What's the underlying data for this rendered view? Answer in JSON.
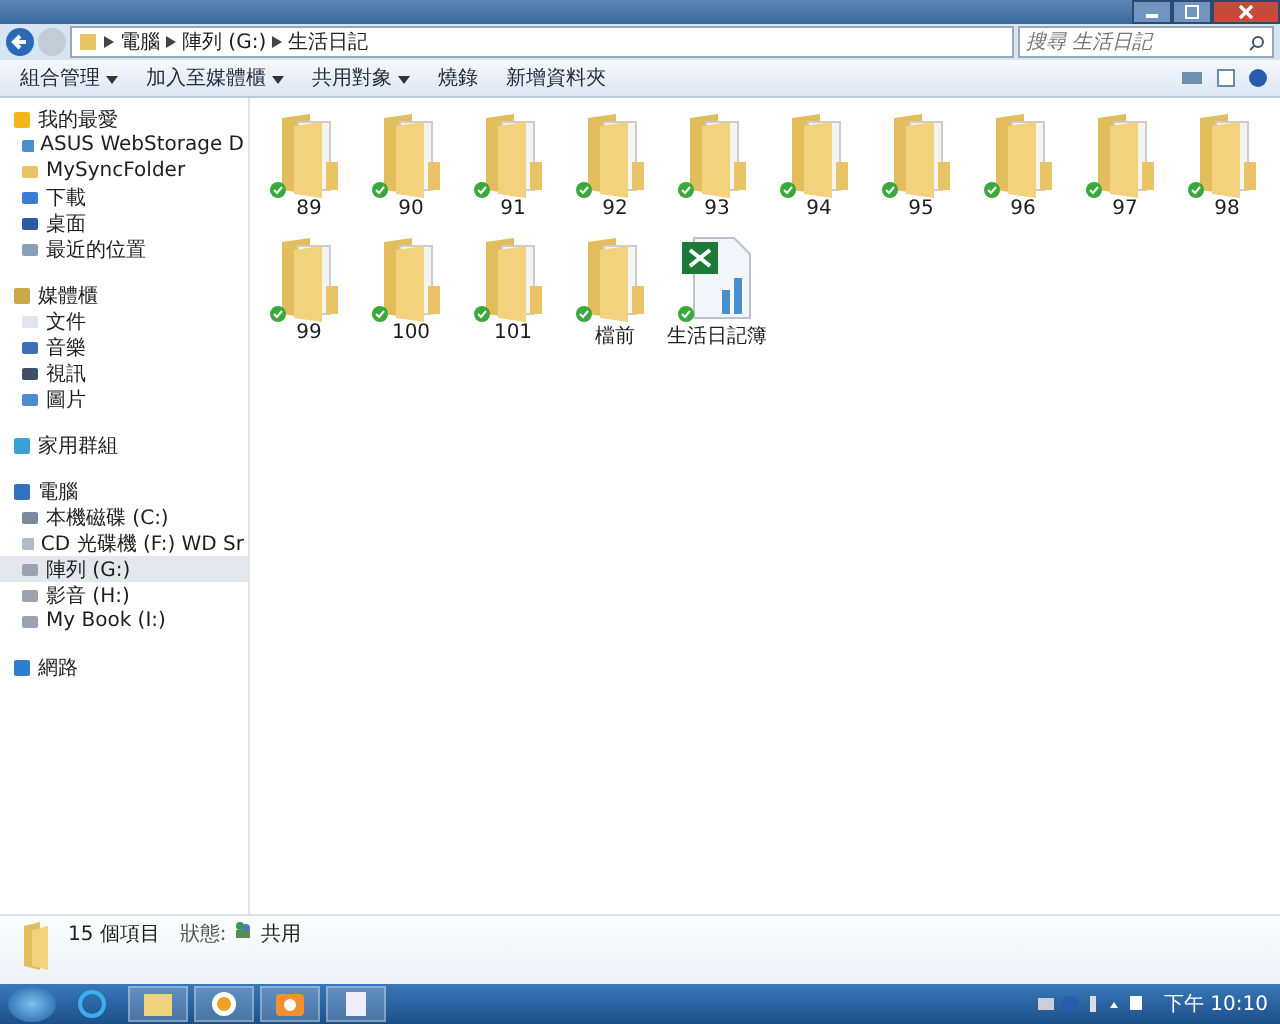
{
  "address": {
    "crumbs": [
      "電腦",
      "陣列 (G:)",
      "生活日記"
    ]
  },
  "search": {
    "placeholder": "搜尋 生活日記"
  },
  "toolbar": {
    "items": [
      {
        "label": "組合管理",
        "dropdown": true
      },
      {
        "label": "加入至媒體櫃",
        "dropdown": true
      },
      {
        "label": "共用對象",
        "dropdown": true
      },
      {
        "label": "燒錄",
        "dropdown": false
      },
      {
        "label": "新增資料夾",
        "dropdown": false
      }
    ]
  },
  "sidebar": {
    "groups": [
      {
        "label": "我的最愛",
        "kind": "star",
        "children": [
          {
            "label": "ASUS WebStorage D",
            "kind": "cloud",
            "selected": false
          },
          {
            "label": "MySyncFolder",
            "kind": "folder",
            "selected": false
          },
          {
            "label": "下載",
            "kind": "download",
            "selected": false
          },
          {
            "label": "桌面",
            "kind": "desktop",
            "selected": false
          },
          {
            "label": "最近的位置",
            "kind": "recent",
            "selected": false
          }
        ]
      },
      {
        "label": "媒體櫃",
        "kind": "library",
        "children": [
          {
            "label": "文件",
            "kind": "doc",
            "selected": false
          },
          {
            "label": "音樂",
            "kind": "music",
            "selected": false
          },
          {
            "label": "視訊",
            "kind": "video",
            "selected": false
          },
          {
            "label": "圖片",
            "kind": "picture",
            "selected": false
          }
        ]
      },
      {
        "label": "家用群組",
        "kind": "homegroup"
      },
      {
        "label": "電腦",
        "kind": "computer",
        "children": [
          {
            "label": "本機磁碟 (C:)",
            "kind": "disk",
            "selected": false
          },
          {
            "label": "CD 光碟機 (F:) WD Sr",
            "kind": "cd",
            "selected": false
          },
          {
            "label": "陣列 (G:)",
            "kind": "drive",
            "selected": true
          },
          {
            "label": "影音 (H:)",
            "kind": "drive",
            "selected": false
          },
          {
            "label": "My Book (I:)",
            "kind": "drive",
            "selected": false
          }
        ]
      },
      {
        "label": "網路",
        "kind": "network"
      }
    ]
  },
  "files": [
    {
      "name": "89",
      "kind": "folder",
      "synced": true
    },
    {
      "name": "90",
      "kind": "folder",
      "synced": true
    },
    {
      "name": "91",
      "kind": "folder",
      "synced": true
    },
    {
      "name": "92",
      "kind": "folder",
      "synced": true
    },
    {
      "name": "93",
      "kind": "folder",
      "synced": true
    },
    {
      "name": "94",
      "kind": "folder",
      "synced": true
    },
    {
      "name": "95",
      "kind": "folder",
      "synced": true
    },
    {
      "name": "96",
      "kind": "folder",
      "synced": true
    },
    {
      "name": "97",
      "kind": "folder",
      "synced": true
    },
    {
      "name": "98",
      "kind": "folder",
      "synced": true
    },
    {
      "name": "99",
      "kind": "folder",
      "synced": true
    },
    {
      "name": "100",
      "kind": "folder",
      "synced": true
    },
    {
      "name": "101",
      "kind": "folder",
      "synced": true
    },
    {
      "name": "檔前",
      "kind": "folder",
      "synced": true
    },
    {
      "name": "生活日記簿",
      "kind": "excel",
      "synced": true
    }
  ],
  "details": {
    "count": "15 個項目",
    "state_label": "狀態:",
    "state": "共用"
  },
  "taskbar": {
    "clock": "下午 10:10"
  }
}
